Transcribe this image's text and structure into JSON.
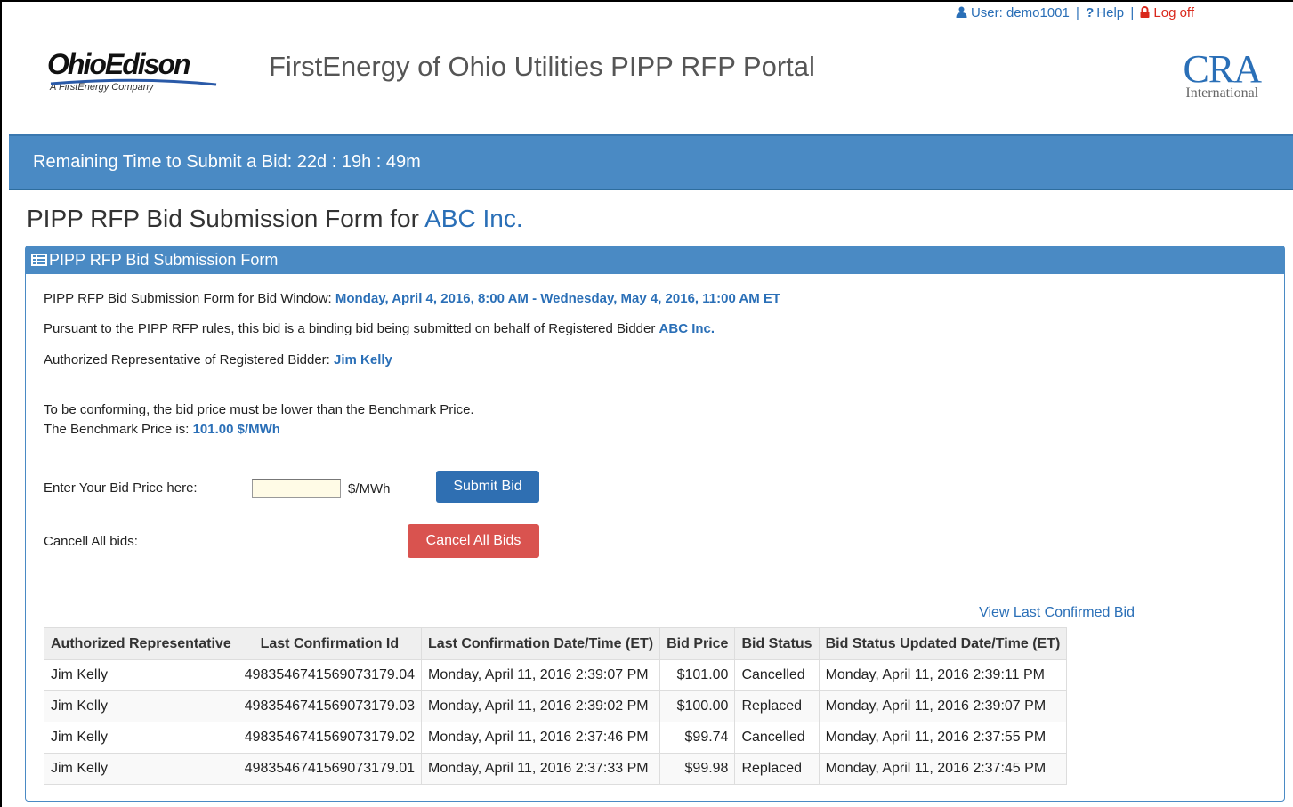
{
  "user_bar": {
    "user_label": "User: demo1001",
    "help_label": "Help",
    "logoff_label": "Log off"
  },
  "header": {
    "logo_text": "OhioEdison",
    "logo_sub": "A FirstEnergy Company",
    "title": "FirstEnergy of Ohio Utilities PIPP RFP Portal",
    "partner_logo_big": "CRA",
    "partner_logo_small": "International"
  },
  "banner": {
    "text": "Remaining Time to Submit a Bid: 22d : 19h : 49m"
  },
  "page": {
    "heading_prefix": "PIPP RFP Bid Submission Form for ",
    "company": "ABC Inc."
  },
  "panel": {
    "title": "PIPP RFP Bid Submission Form",
    "window_label": "PIPP RFP Bid Submission Form for Bid Window: ",
    "window_value": "Monday, April 4, 2016, 8:00 AM - Wednesday, May 4, 2016, 11:00 AM ET",
    "pursuant_label": "Pursuant to the PIPP RFP rules, this bid is a binding bid being submitted on behalf of Registered Bidder ",
    "pursuant_value": "ABC Inc.",
    "rep_label": "Authorized Representative of Registered Bidder: ",
    "rep_value": "Jim Kelly",
    "conforming_text": "To be conforming, the bid price must be lower than the Benchmark Price.",
    "benchmark_label": "The Benchmark Price is: ",
    "benchmark_value": "101.00 $/MWh",
    "bid_price_label": "Enter Your Bid Price here:",
    "bid_price_value": "",
    "bid_unit": "$/MWh",
    "submit_label": "Submit Bid",
    "cancel_all_label": "Cancell All bids:",
    "cancel_button_label": "Cancel All Bids",
    "view_last_label": "View Last Confirmed Bid"
  },
  "table": {
    "headers": [
      "Authorized Representative",
      "Last Confirmation Id",
      "Last Confirmation Date/Time (ET)",
      "Bid Price",
      "Bid Status",
      "Bid Status Updated Date/Time (ET)"
    ],
    "rows": [
      [
        "Jim Kelly",
        "49835467415690731​79.04",
        "Monday, April 11, 2016 2:39:07 PM",
        "$101.00",
        "Cancelled",
        "Monday, April 11, 2016 2:39:11 PM"
      ],
      [
        "Jim Kelly",
        "4983546741569073179.03",
        "Monday, April 11, 2016 2:39:02 PM",
        "$100.00",
        "Replaced",
        "Monday, April 11, 2016 2:39:07 PM"
      ],
      [
        "Jim Kelly",
        "4983546741569073179.02",
        "Monday, April 11, 2016 2:37:46 PM",
        "$99.74",
        "Cancelled",
        "Monday, April 11, 2016 2:37:55 PM"
      ],
      [
        "Jim Kelly",
        "4983546741569073179.01",
        "Monday, April 11, 2016 2:37:33 PM",
        "$99.98",
        "Replaced",
        "Monday, April 11, 2016 2:37:45 PM"
      ]
    ]
  }
}
